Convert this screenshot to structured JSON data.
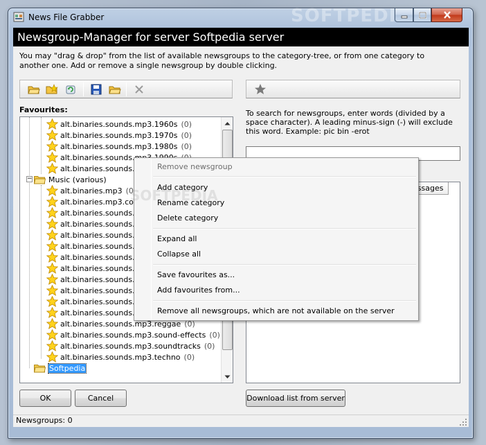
{
  "window": {
    "title": "News File Grabber",
    "watermark": "SOFTPEDIA"
  },
  "header": {
    "title": "Newsgroup-Manager for server Softpedia server"
  },
  "instructions": "You may \"drag & drop\" from the list of available newsgroups to the category-tree, or from one category to another one. Add or remove a single newsgroup by double clicking.",
  "left_panel": {
    "toolbar": [
      "open-folder-icon",
      "open-folder-star-icon",
      "refresh-icon",
      "save-icon",
      "folder-icon",
      "delete-icon"
    ],
    "favourites_label": "Favourites:",
    "tree": {
      "items_top": [
        {
          "name": "alt.binaries.sounds.mp3.1960s",
          "count": "(0)"
        },
        {
          "name": "alt.binaries.sounds.mp3.1970s",
          "count": "(0)"
        },
        {
          "name": "alt.binaries.sounds.mp3.1980s",
          "count": "(0)"
        },
        {
          "name": "alt.binaries.sounds.mp3.1990s",
          "count": "(0)"
        },
        {
          "name": "alt.binaries.sounds.m",
          "count": ""
        }
      ],
      "category_music": "Music (various)",
      "items_music": [
        {
          "name": "alt.binaries.mp3",
          "count": "(0)"
        },
        {
          "name": "alt.binaries.mp3.comp",
          "count": ""
        },
        {
          "name": "alt.binaries.sounds.m",
          "count": ""
        },
        {
          "name": "alt.binaries.sounds.m",
          "count": ""
        },
        {
          "name": "alt.binaries.sounds.m",
          "count": ""
        },
        {
          "name": "alt.binaries.sounds.m",
          "count": ""
        },
        {
          "name": "alt.binaries.sounds.m",
          "count": ""
        },
        {
          "name": "alt.binaries.sounds.m",
          "count": ""
        },
        {
          "name": "alt.binaries.sounds.m",
          "count": ""
        },
        {
          "name": "alt.binaries.sounds.m",
          "count": ""
        },
        {
          "name": "alt.binaries.sounds.m",
          "count": ""
        },
        {
          "name": "alt.binaries.sounds.m",
          "count": ""
        },
        {
          "name": "alt.binaries.sounds.mp3.reggae",
          "count": "(0)"
        },
        {
          "name": "alt.binaries.sounds.mp3.sound-effects",
          "count": "(0)"
        },
        {
          "name": "alt.binaries.sounds.mp3.soundtracks",
          "count": "(0)"
        },
        {
          "name": "alt.binaries.sounds.mp3.techno",
          "count": "(0)"
        }
      ],
      "category_softpedia": "Softpedia"
    },
    "ok_label": "OK",
    "cancel_label": "Cancel"
  },
  "right_panel": {
    "toolbar": [
      "star-icon"
    ],
    "search_hint": "To search for newsgroups, enter words (divided by a space character). A leading minus-sign (-) will exclude this word. Example: pic bin -erot",
    "search_value": "",
    "columns": {
      "messages": "essages"
    },
    "download_label": "Download list from server"
  },
  "context_menu": {
    "remove_newsgroup": "Remove newsgroup",
    "add_category": "Add category",
    "rename_category": "Rename category",
    "delete_category": "Delete category",
    "expand_all": "Expand all",
    "collapse_all": "Collapse all",
    "save_favourites": "Save favourites as...",
    "add_favourites": "Add favourites from...",
    "remove_all": "Remove all newsgroups, which are not available on the server",
    "watermark": "SOFTPEDIA"
  },
  "status": {
    "text": "Newsgroups: 0"
  },
  "colors": {
    "header_bg": "#000000",
    "selection": "#3399ff",
    "close": "#c2381a"
  }
}
